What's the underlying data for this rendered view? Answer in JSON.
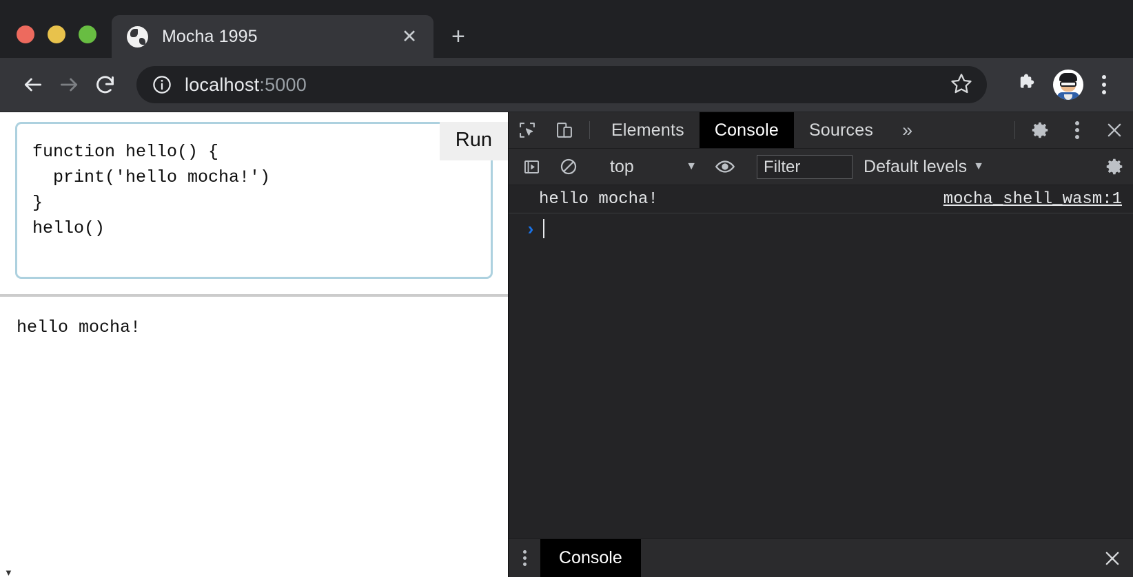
{
  "browser": {
    "traffic_lights": [
      {
        "name": "close",
        "color": "#ED6A5E"
      },
      {
        "name": "minimize",
        "color": "#E8C24C"
      },
      {
        "name": "zoom",
        "color": "#68BD42"
      }
    ],
    "tab": {
      "title": "Mocha 1995",
      "favicon": "globe-icon",
      "close_label": "✕"
    },
    "new_tab_label": "+",
    "toolbar": {
      "back_icon": "back-arrow-icon",
      "forward_icon": "forward-arrow-icon",
      "reload_icon": "reload-icon",
      "info_icon": "info-circle-icon",
      "url_host": "localhost",
      "url_port": ":5000",
      "star_icon": "bookmark-star-icon",
      "extensions_icon": "puzzle-piece-icon",
      "avatar_icon": "profile-avatar",
      "menu_icon": "three-dot-menu-icon"
    }
  },
  "page": {
    "editor": {
      "code": "function hello() {\n  print('hello mocha!')\n}\nhello()"
    },
    "run_button_label": "Run",
    "output_text": "hello mocha!"
  },
  "devtools": {
    "toolbar": {
      "inspect_icon": "inspect-element-icon",
      "device_icon": "device-toggle-icon",
      "tabs": [
        {
          "label": "Elements",
          "selected": false
        },
        {
          "label": "Console",
          "selected": true
        },
        {
          "label": "Sources",
          "selected": false
        }
      ],
      "more_tabs_label": "»",
      "settings_icon": "gear-icon",
      "menu_icon": "three-dot-menu-icon",
      "close_icon": "close-icon"
    },
    "filterbar": {
      "execute_icon": "execute-sidebar-icon",
      "clear_icon": "clear-console-icon",
      "context": "top",
      "context_caret": "▼",
      "eye_icon": "live-expression-eye-icon",
      "filter_placeholder": "Filter",
      "filter_value": "",
      "levels_label": "Default levels",
      "levels_caret": "▼",
      "console_settings_icon": "gear-icon"
    },
    "console": {
      "messages": [
        {
          "text": "hello mocha!",
          "source": "mocha_shell_wasm:1"
        }
      ],
      "prompt_chevron": "›"
    },
    "drawer": {
      "kebab_icon": "three-dot-menu-icon",
      "tab_label": "Console",
      "close_icon": "close-icon"
    }
  },
  "colors": {
    "chrome_bg": "#202124",
    "toolbar_bg": "#35363A",
    "devtools_bg": "#242426",
    "devtools_bar_bg": "#2B2B2D",
    "selected_tab_bg": "#000000",
    "editor_border": "#ADD1DF",
    "run_button_bg": "#EFEFEF",
    "prompt_blue": "#1A73E8"
  }
}
